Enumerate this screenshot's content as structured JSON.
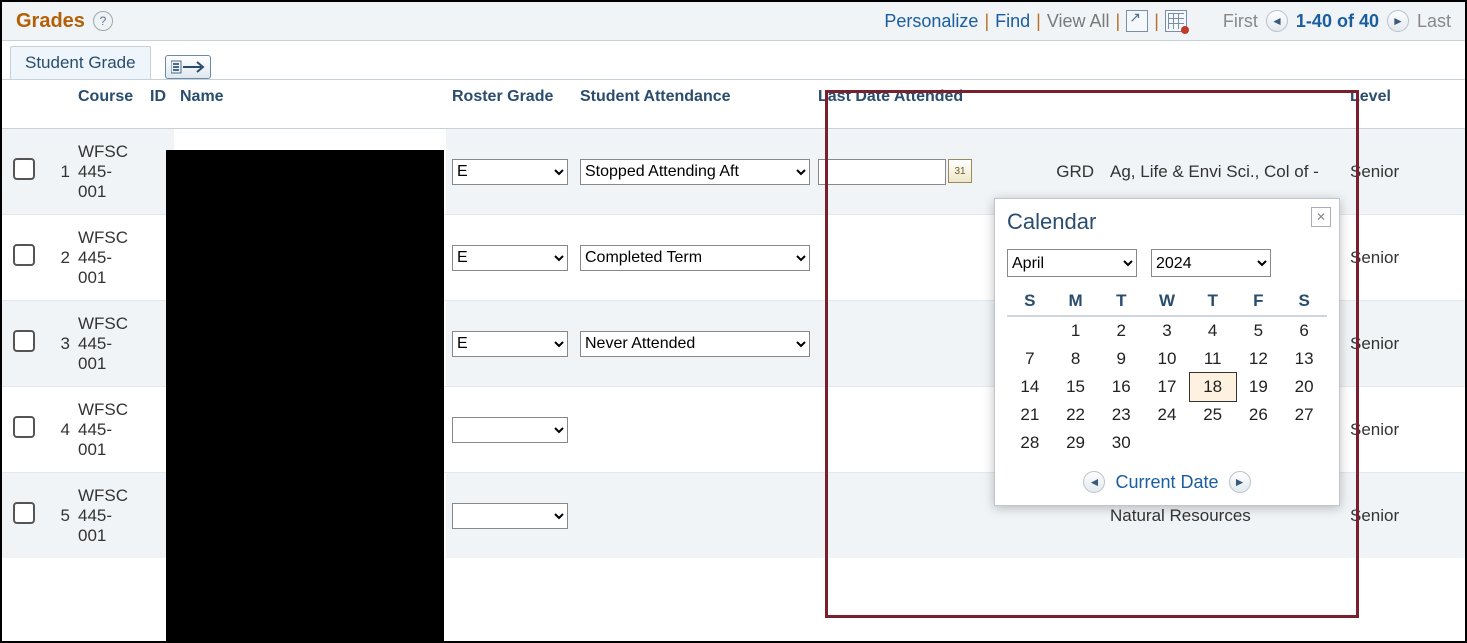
{
  "header": {
    "title": "Grades",
    "personalize": "Personalize",
    "find": "Find",
    "viewall": "View All",
    "first": "First",
    "range": "1-40 of 40",
    "last": "Last"
  },
  "tab": {
    "label": "Student Grade"
  },
  "columns": {
    "course": "Course",
    "id": "ID",
    "name": "Name",
    "roster": "Roster Grade",
    "attendance": "Student Attendance",
    "lastdate": "Last Date Attended",
    "level": "Level"
  },
  "grade_options": [
    "",
    "E"
  ],
  "attendance_options": [
    "",
    "Stopped Attending After",
    "Completed Term",
    "Never Attended"
  ],
  "rows": [
    {
      "n": "1",
      "course": "WFSC 445-001",
      "grade": "E",
      "att": "Stopped Attending After",
      "grd": "GRD",
      "college": "Ag, Life & Envi Sci., Col of -",
      "level": "Senior",
      "has_date_input": true
    },
    {
      "n": "2",
      "course": "WFSC 445-001",
      "grade": "E",
      "att": "Completed Term",
      "grd": "",
      "college": "",
      "level": "Senior",
      "has_date_input": false
    },
    {
      "n": "3",
      "course": "WFSC 445-001",
      "grade": "E",
      "att": "Never Attended",
      "grd": "",
      "college": "",
      "level": "Senior",
      "has_date_input": false
    },
    {
      "n": "4",
      "course": "WFSC 445-001",
      "grade": "",
      "att": "",
      "grd": "",
      "college": "",
      "level": "Senior",
      "has_date_input": false
    },
    {
      "n": "5",
      "course": "WFSC 445-001",
      "grade": "",
      "att": "",
      "grd": "",
      "college": "Natural Resources",
      "level": "Senior",
      "has_date_input": false
    }
  ],
  "calendar": {
    "title": "Calendar",
    "month": "April",
    "year": "2024",
    "months": [
      "April"
    ],
    "years": [
      "2024"
    ],
    "dow": [
      "S",
      "M",
      "T",
      "W",
      "T",
      "F",
      "S"
    ],
    "weeks": [
      [
        "",
        "1",
        "2",
        "3",
        "4",
        "5",
        "6"
      ],
      [
        "7",
        "8",
        "9",
        "10",
        "11",
        "12",
        "13"
      ],
      [
        "14",
        "15",
        "16",
        "17",
        "18",
        "19",
        "20"
      ],
      [
        "21",
        "22",
        "23",
        "24",
        "25",
        "26",
        "27"
      ],
      [
        "28",
        "29",
        "30",
        "",
        "",
        "",
        ""
      ]
    ],
    "today": "18",
    "current_date_label": "Current Date"
  }
}
